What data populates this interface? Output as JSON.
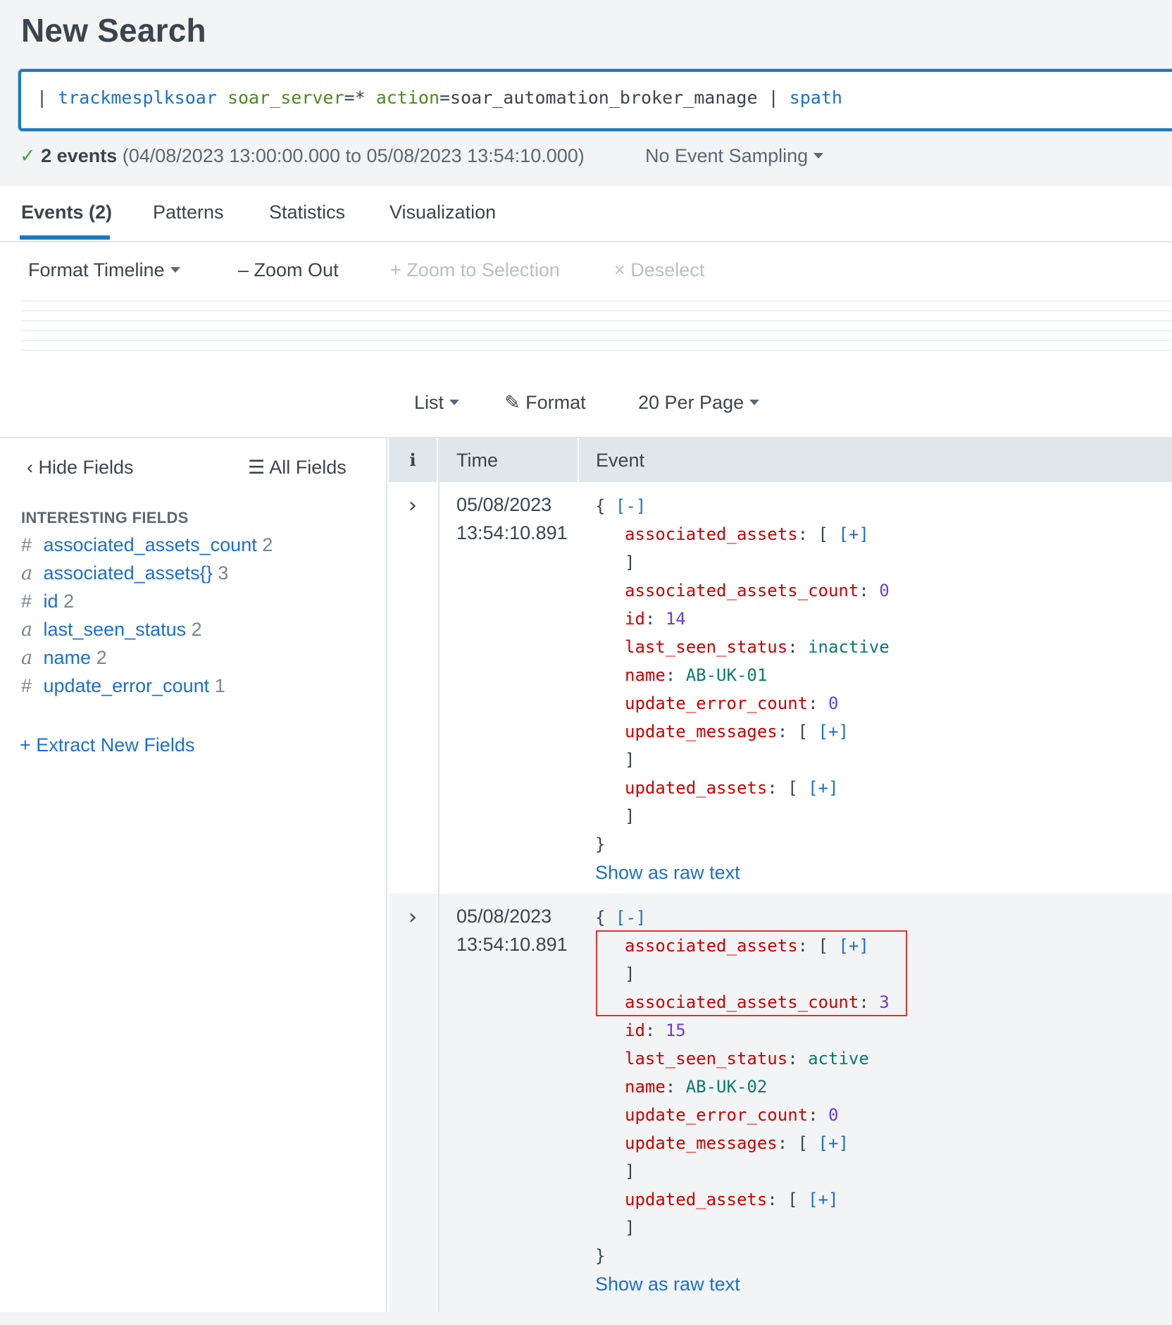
{
  "header": {
    "title": "New Search"
  },
  "search": {
    "pipe1": "| ",
    "cmd1": "trackmesplksoar",
    "arg1": "soar_server",
    "val1": "=* ",
    "arg2": "action",
    "val2": "=soar_automation_broker_manage | ",
    "cmd2": "spath"
  },
  "status": {
    "check": "✓",
    "count": "2 events",
    "range": " (04/08/2023 13:00:00.000 to 05/08/2023 13:54:10.000)",
    "sampling": "No Event Sampling"
  },
  "tabs": [
    "Events (2)",
    "Patterns",
    "Statistics",
    "Visualization"
  ],
  "timeline": {
    "format": "Format Timeline",
    "zoom_out": "Zoom Out",
    "zoom_sel": "Zoom to Selection",
    "deselect": "Deselect"
  },
  "list_controls": {
    "list": "List",
    "format": "Format",
    "per_page": "20 Per Page"
  },
  "fields": {
    "hide": "Hide Fields",
    "all": "All Fields",
    "interesting_label": "INTERESTING FIELDS",
    "items": [
      {
        "type": "#",
        "name": "associated_assets_count",
        "count": "2"
      },
      {
        "type": "a",
        "name": "associated_assets{}",
        "count": "3"
      },
      {
        "type": "#",
        "name": "id",
        "count": "2"
      },
      {
        "type": "a",
        "name": "last_seen_status",
        "count": "2"
      },
      {
        "type": "a",
        "name": "name",
        "count": "2"
      },
      {
        "type": "#",
        "name": "update_error_count",
        "count": "1"
      }
    ],
    "extract": "Extract New Fields"
  },
  "table": {
    "col_info": "i",
    "col_time": "Time",
    "col_event": "Event"
  },
  "events": [
    {
      "date": "05/08/2023",
      "time": "13:54:10.891",
      "assets_count": "0",
      "id": "14",
      "status": "inactive",
      "name": "AB-UK-01",
      "error_count": "0",
      "raw": "Show as raw text"
    },
    {
      "date": "05/08/2023",
      "time": "13:54:10.891",
      "assets_count": "3",
      "id": "15",
      "status": "active",
      "name": "AB-UK-02",
      "error_count": "0",
      "raw": "Show as raw text"
    }
  ],
  "json_keys": {
    "open": "{ ",
    "collapse": "[-]",
    "associated_assets": "associated_assets",
    "associated_assets_count": "associated_assets_count",
    "id": "id",
    "last_seen_status": "last_seen_status",
    "name": "name",
    "update_error_count": "update_error_count",
    "update_messages": "update_messages",
    "updated_assets": "updated_assets",
    "expand": "[+]",
    "arr_open": ": [ ",
    "arr_close": "]",
    "sep": ": ",
    "close": "}"
  },
  "colors": {
    "accent": "#1a7ac0",
    "link": "#1a6fd1",
    "json_key": "#cc0000",
    "json_number": "#6a3fd1",
    "json_string": "#0b7a6d",
    "highlight_box": "#e0332e"
  }
}
